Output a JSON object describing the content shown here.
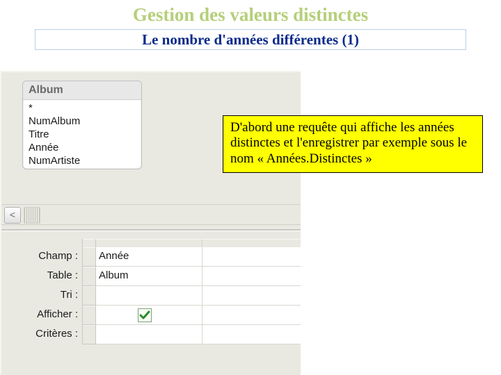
{
  "heading": "Gestion des valeurs distinctes",
  "subtitle": "Le nombre d'années différentes (1)",
  "table": {
    "title": "Album",
    "fields": [
      "*",
      "NumAlbum",
      "Titre",
      "Année",
      "NumArtiste"
    ]
  },
  "nav": {
    "back_glyph": "<"
  },
  "grid": {
    "rows": {
      "champ": {
        "label": "Champ :",
        "value": "Année"
      },
      "table": {
        "label": "Table :",
        "value": "Album"
      },
      "tri": {
        "label": "Tri :",
        "value": ""
      },
      "afficher": {
        "label": "Afficher :",
        "checked": true
      },
      "criteres": {
        "label": "Critères :",
        "value": ""
      }
    }
  },
  "callout": {
    "text": "D'abord une requête qui affiche les années distinctes et l'enregistrer par exemple sous le nom « Années.Distinctes »"
  }
}
